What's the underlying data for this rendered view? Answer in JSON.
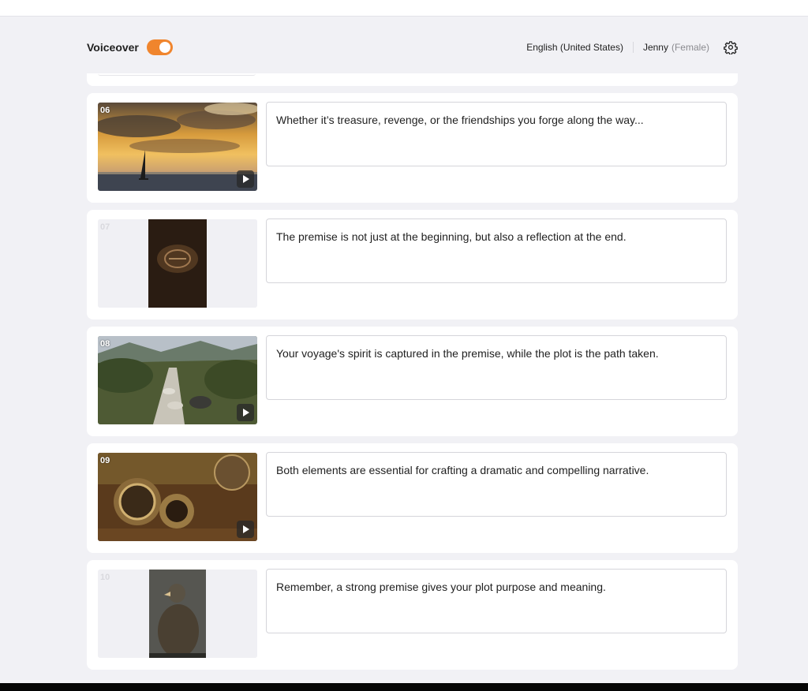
{
  "header": {
    "voiceover_label": "Voiceover",
    "voiceover_on": true,
    "language": "English (United States)",
    "voice_name": "Jenny",
    "voice_gender": "(Female)"
  },
  "colors": {
    "accent": "#f0852d",
    "background": "#f1f1f5",
    "card": "#ffffff"
  },
  "scenes": [
    {
      "number": "06",
      "text": "Whether it’s treasure, revenge, or the friendships you forge along the way...",
      "image": "sailboat-at-sunset",
      "has_play": true
    },
    {
      "number": "07",
      "text": "The premise is not just at the beginning, but also a reflection at the end.",
      "image": "compass-in-dark",
      "has_play": false
    },
    {
      "number": "08",
      "text": "Your voyage's spirit is captured in the premise, while the plot is the path taken.",
      "image": "stone-path-in-field",
      "has_play": true
    },
    {
      "number": "09",
      "text": "Both elements are essential for crafting a dramatic and compelling narrative.",
      "image": "antique-navigation-instruments",
      "has_play": true
    },
    {
      "number": "10",
      "text": "Remember, a strong premise gives your plot purpose and meaning.",
      "image": "perched-eagle",
      "has_play": false
    }
  ]
}
